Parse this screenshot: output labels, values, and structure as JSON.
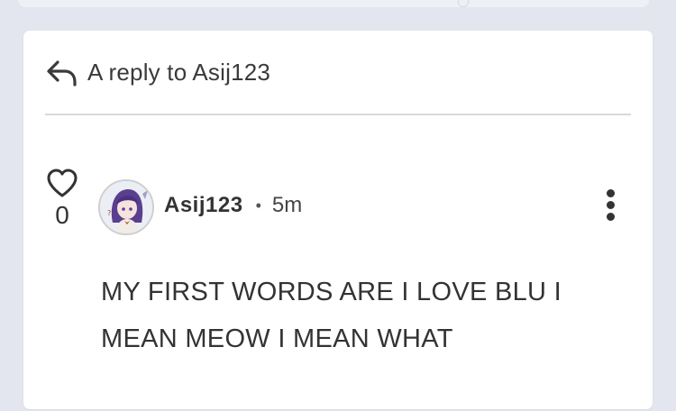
{
  "reply": {
    "header_text": "A reply to Asij123"
  },
  "post": {
    "like_count": "0",
    "username": "Asij123",
    "separator": "•",
    "time_ago": "5m",
    "message": "MY FIRST WORDS ARE I LOVE BLU I MEAN MEOW I MEAN WHAT"
  },
  "icons": {
    "reply": "reply-arrow-icon",
    "like": "heart-icon",
    "more": "vertical-ellipsis-icon"
  },
  "colors": {
    "background": "#e3e6ee",
    "card": "#ffffff",
    "text": "#333333",
    "divider": "#d8d8d8"
  }
}
